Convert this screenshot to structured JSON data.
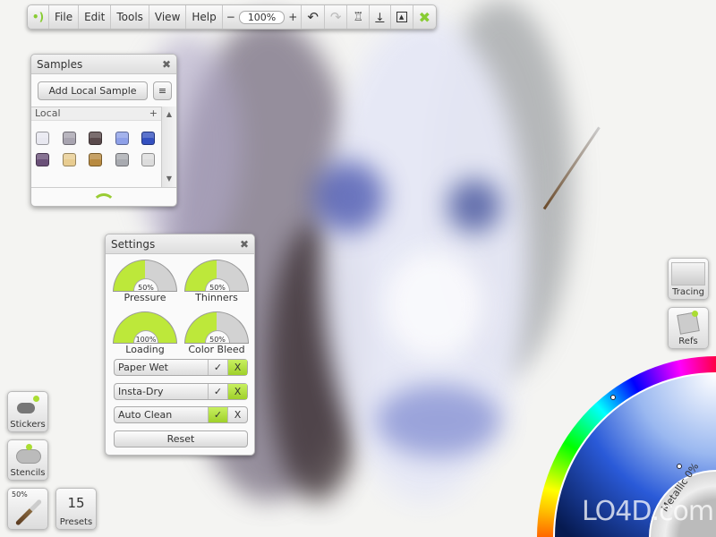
{
  "toolbar": {
    "menus": [
      "File",
      "Edit",
      "Tools",
      "View",
      "Help"
    ],
    "zoom_minus": "−",
    "zoom": "100%",
    "zoom_plus": "+",
    "icons": [
      "logo-icon",
      "undo-icon",
      "redo-icon",
      "canvas-easel-icon",
      "drop-down-icon",
      "frame-icon",
      "close-x-icon"
    ]
  },
  "samples": {
    "title": "Samples",
    "close": "✖",
    "add_button": "Add Local Sample",
    "section": "Local",
    "add": "+",
    "scroll_up": "▲",
    "scroll_down": "▼",
    "swatches": [
      "#e8e8f0",
      "#a8a4b0",
      "#5a4a4c",
      "#8ea0e8",
      "#3450c0",
      "#6a5078",
      "#e8cc90",
      "#b88a40",
      "#a8aab0",
      "#dcdcdc"
    ]
  },
  "settings": {
    "title": "Settings",
    "close": "✖",
    "gauges": [
      {
        "label": "Pressure",
        "value": "50%",
        "fraction": 0.5
      },
      {
        "label": "Thinners",
        "value": "50%",
        "fraction": 0.5
      },
      {
        "label": "Loading",
        "value": "100%",
        "fraction": 1.0
      },
      {
        "label": "Color Bleed",
        "value": "50%",
        "fraction": 0.5
      }
    ],
    "toggles": [
      {
        "label": "Paper Wet",
        "check": "✓",
        "x": "X",
        "on": false
      },
      {
        "label": "Insta-Dry",
        "check": "✓",
        "x": "X",
        "on": false
      },
      {
        "label": "Auto Clean",
        "check": "✓",
        "x": "X",
        "on": true
      }
    ],
    "reset": "Reset"
  },
  "left": {
    "stickers": "Stickers",
    "stencils": "Stencils",
    "brush_size": "50%",
    "presets_count": "15",
    "presets": "Presets"
  },
  "right": {
    "tracing": "Tracing",
    "refs": "Refs"
  },
  "color": {
    "metallic": "Metallic 0%",
    "selected_color": "#2a5ad8"
  },
  "accent": "#a6d62e",
  "watermark": "LO4D.com"
}
